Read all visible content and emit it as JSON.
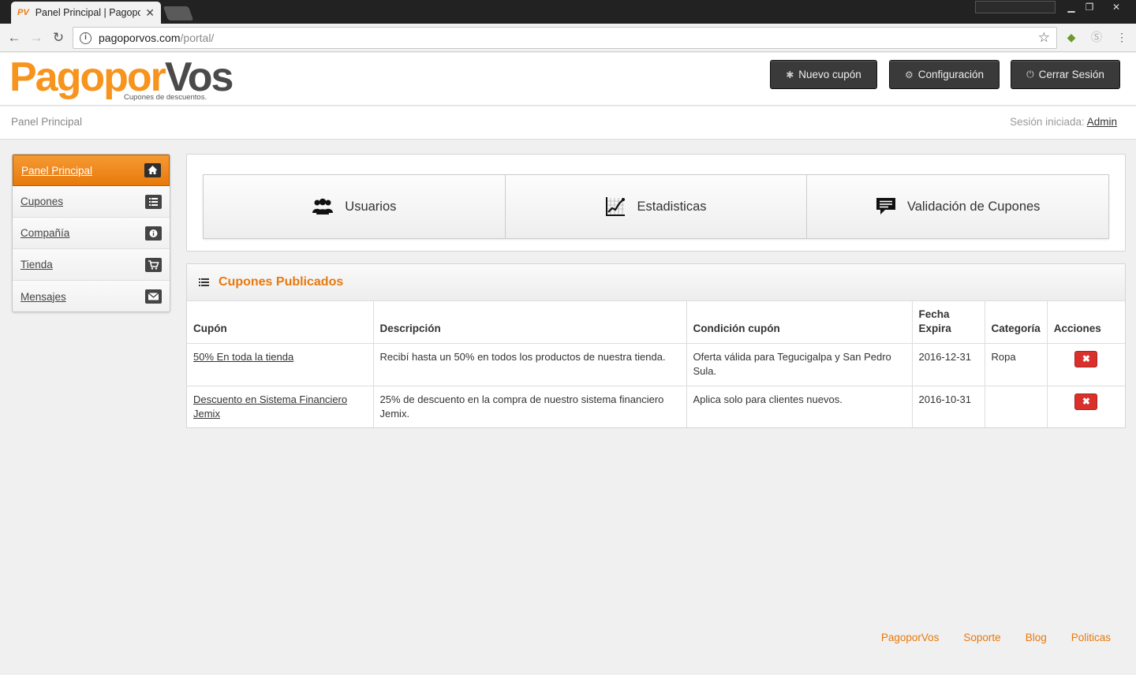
{
  "browser": {
    "tab_title": "Panel Principal | Pagopor",
    "tab_favicon": "PV",
    "url_host": "pagoporvos.com",
    "url_path": "/portal/"
  },
  "header": {
    "logo_part1": "Pagopor",
    "logo_part2": "Vos",
    "logo_tagline": "Cupones de descuentos.",
    "new_coupon_label": "Nuevo cupón",
    "settings_label": "Configuración",
    "logout_label": "Cerrar Sesión"
  },
  "breadcrumb": {
    "current": "Panel Principal",
    "session_prefix": "Sesión iniciada:",
    "session_user": "Admin"
  },
  "sidebar": {
    "items": [
      {
        "label": "Panel Principal",
        "icon": "home-icon"
      },
      {
        "label": "Cupones",
        "icon": "list-icon"
      },
      {
        "label": "Compañía",
        "icon": "info-icon"
      },
      {
        "label": "Tienda",
        "icon": "cart-icon"
      },
      {
        "label": "Mensajes",
        "icon": "envelope-icon"
      }
    ]
  },
  "quick": {
    "users_label": "Usuarios",
    "stats_label": "Estadisticas",
    "validation_label": "Validación de Cupones"
  },
  "coupons": {
    "title": "Cupones Publicados",
    "columns": [
      "Cupón",
      "Descripción",
      "Condición cupón",
      "Fecha Expira",
      "Categoría",
      "Acciones"
    ],
    "rows": [
      {
        "coupon": "50% En toda la tienda",
        "description": "Recibí hasta un 50% en todos los productos de nuestra tienda.",
        "condition": "Oferta válida para Tegucigalpa y San Pedro Sula.",
        "expires": "2016-12-31",
        "category": "Ropa"
      },
      {
        "coupon": "Descuento en Sistema Financiero Jemix",
        "description": "25% de descuento en la compra de nuestro sistema financiero Jemix.",
        "condition": "Aplica solo para clientes nuevos.",
        "expires": "2016-10-31",
        "category": ""
      }
    ]
  },
  "footer": {
    "links": [
      "PagoporVos",
      "Soporte",
      "Blog",
      "Politicas"
    ]
  },
  "colors": {
    "accent": "#e8790c",
    "danger": "#d9302b",
    "dark_button": "#3a3a3a"
  }
}
